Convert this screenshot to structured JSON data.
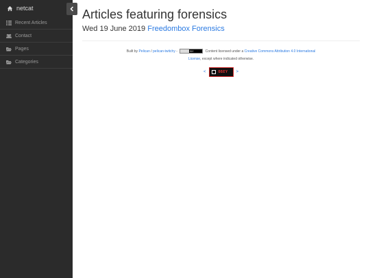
{
  "sidebar": {
    "brand": {
      "label": "netcat",
      "icon": "home-icon"
    },
    "items": [
      {
        "label": "Recent Articles",
        "icon": "list-icon"
      },
      {
        "label": "Contact",
        "icon": "users-icon"
      },
      {
        "label": "Pages",
        "icon": "folder-open-icon"
      },
      {
        "label": "Categories",
        "icon": "folder-open-icon"
      }
    ],
    "toggle_icon": "chevron-left-icon"
  },
  "main": {
    "title": "Articles featuring forensics",
    "date": "Wed 19 June 2019",
    "article_link": "Freedombox Forensics"
  },
  "footer": {
    "built_by": "Built by",
    "pelican_link": "Pelican",
    "sep": "/",
    "theme_link": "pelican-twitchy",
    "dash": "-",
    "cc_badge_text": "BY",
    "license_pre": "Content licensed under a",
    "license_link_1": "Creative Commons Attribution 4.0 International",
    "license_link_2": "License",
    "license_post": ", except where indicated otherwise."
  },
  "webring": {
    "prev": "<",
    "next": ">",
    "badge_text": "OBEY"
  },
  "colors": {
    "sidebar_bg": "#2b2b2b",
    "link": "#2a7ae2",
    "text": "#333333"
  }
}
